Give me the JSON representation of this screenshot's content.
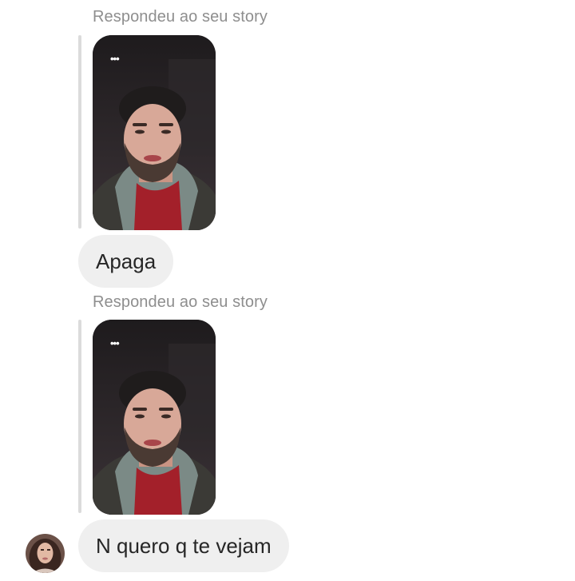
{
  "thread": {
    "messages": [
      {
        "reply_label": "Respondeu ao seu story",
        "story_overlay_icon": "more-dots-icon",
        "text": "Apaga"
      },
      {
        "reply_label": "Respondeu ao seu story",
        "story_overlay_icon": "more-dots-icon",
        "text": "N quero q te vejam"
      }
    ]
  },
  "colors": {
    "bubble_background": "#efefef",
    "bubble_text": "#262626",
    "meta_text": "#8e8e8e",
    "quote_bar": "#dbdbdb"
  }
}
